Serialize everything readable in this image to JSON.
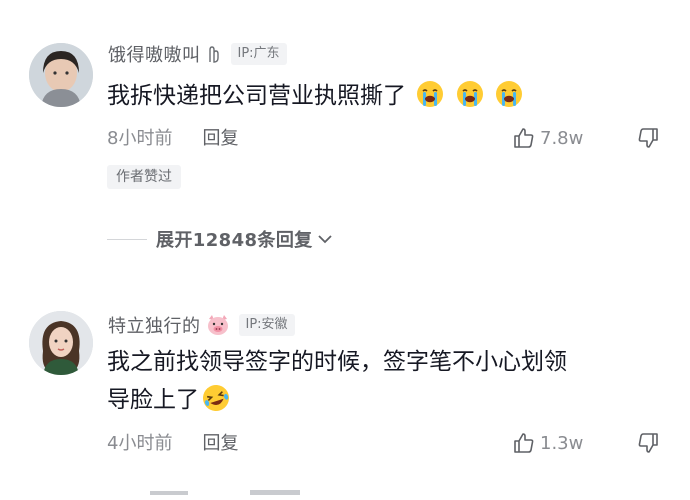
{
  "comments": [
    {
      "username": "饿得嗷嗷叫",
      "name_emoji_icon": "hand-icon",
      "ip": "IP:广东",
      "text": "我拆快递把公司营业执照撕了",
      "text_line2": "",
      "emojis": [
        "crying-face-icon",
        "crying-face-icon",
        "crying-face-icon"
      ],
      "time": "8小时前",
      "reply": "回复",
      "likes": "7.8w",
      "author_liked": "作者赞过",
      "expand": "展开12848条回复"
    },
    {
      "username": "特立独行的",
      "name_emoji_icon": "pig-icon",
      "ip": "IP:安徽",
      "text": "我之前找领导签字的时候，签字笔不小心划领",
      "text_line2": "导脸上了",
      "emojis": [
        "laughing-face-icon"
      ],
      "time": "4小时前",
      "reply": "回复",
      "likes": "1.3w"
    }
  ],
  "colors": {
    "accent_text": "#161823",
    "secondary_text": "#8a8c91",
    "badge_bg": "#f2f3f5"
  }
}
